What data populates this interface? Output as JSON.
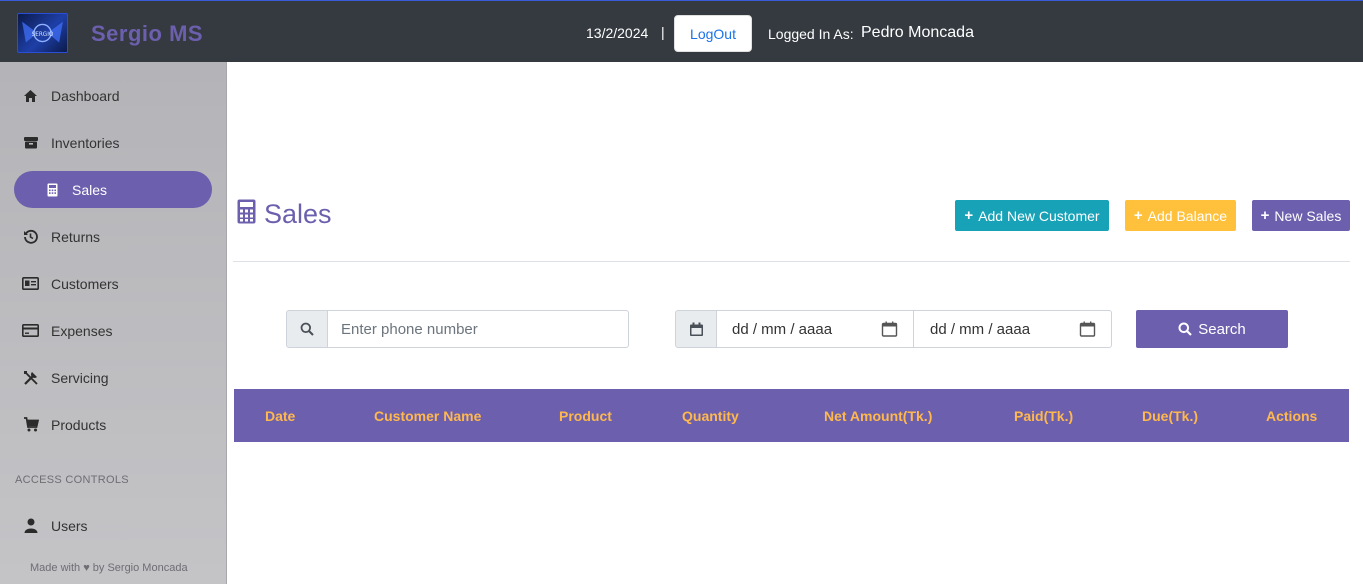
{
  "header": {
    "brand": "Sergio MS",
    "logo_text": "SERGIO",
    "date": "13/2/2024",
    "separator": "|",
    "logout_label": "LogOut",
    "logged_in_label": "Logged In As:",
    "user_name": "Pedro Moncada"
  },
  "sidebar": {
    "items": [
      {
        "label": "Dashboard",
        "icon": "home-icon"
      },
      {
        "label": "Inventories",
        "icon": "archive-icon"
      },
      {
        "label": "Sales",
        "icon": "calculator-icon",
        "active": true
      },
      {
        "label": "Returns",
        "icon": "history-icon"
      },
      {
        "label": "Customers",
        "icon": "id-card-icon"
      },
      {
        "label": "Expenses",
        "icon": "credit-card-icon"
      },
      {
        "label": "Servicing",
        "icon": "tools-icon"
      },
      {
        "label": "Products",
        "icon": "cart-icon"
      }
    ],
    "section_title": "ACCESS CONTROLS",
    "access_items": [
      {
        "label": "Users",
        "icon": "user-icon"
      }
    ],
    "footer": "Made with ♥ by Sergio Moncada"
  },
  "main": {
    "title": "Sales",
    "buttons": {
      "add_customer": "Add New Customer",
      "add_balance": "Add Balance",
      "new_sales": "New Sales",
      "plus": "+"
    },
    "filters": {
      "phone_placeholder": "Enter phone number",
      "date_from": "dd / mm / aaaa",
      "date_to": "dd / mm / aaaa",
      "search_label": "Search"
    },
    "table": {
      "columns": [
        "Date",
        "Customer Name",
        "Product",
        "Quantity",
        "Net Amount(Tk.)",
        "Paid(Tk.)",
        "Due(Tk.)",
        "Actions"
      ],
      "rows": []
    }
  },
  "colors": {
    "accent": "#6c5fad",
    "topbar": "#343a40",
    "info": "#17a2b8",
    "warning": "#ffc13b",
    "table_header_text": "#ffb84d"
  }
}
